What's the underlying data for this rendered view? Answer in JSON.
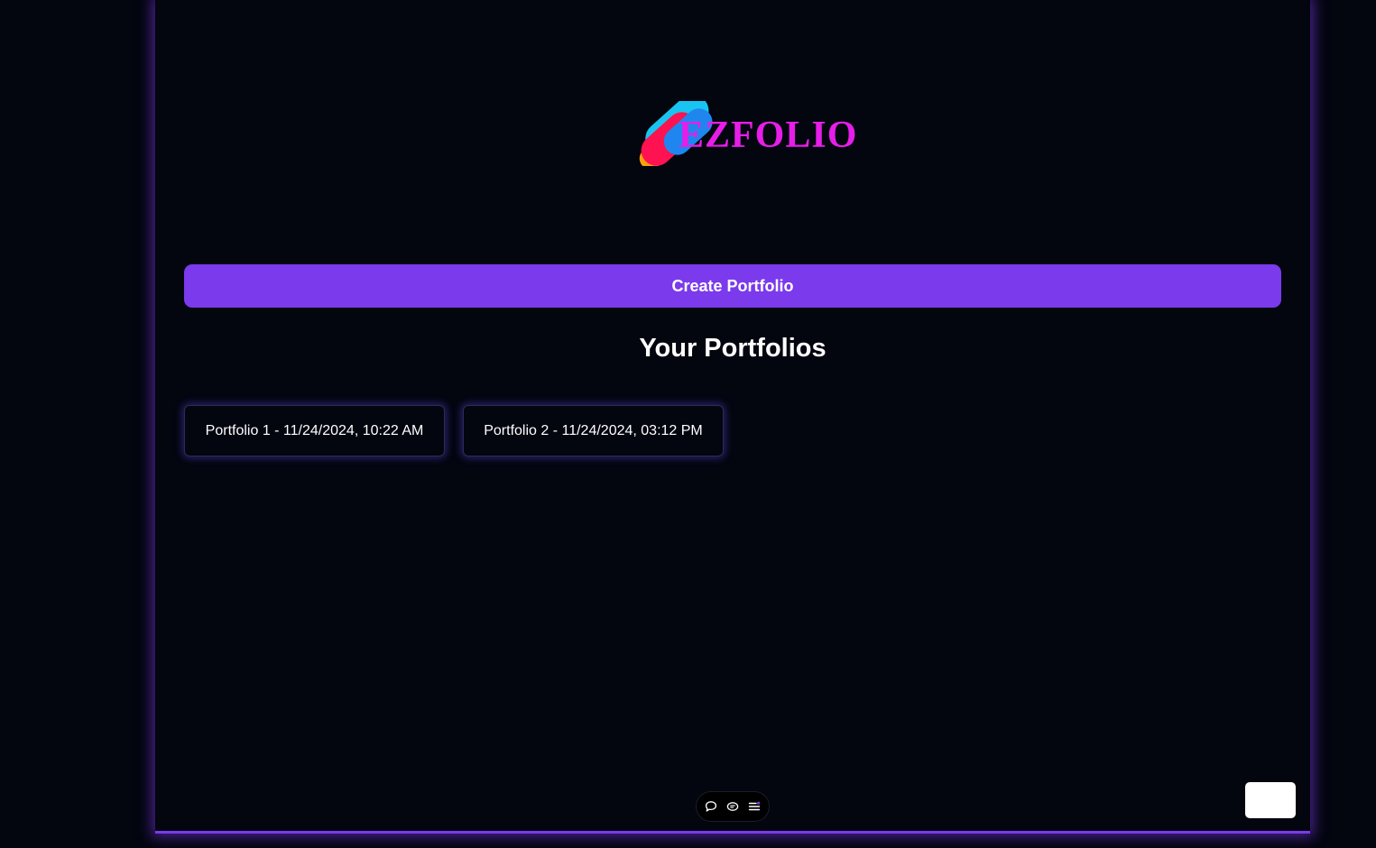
{
  "brand": {
    "name": "EZFOLIO",
    "logo_icon": "ezfolio-logo-icon",
    "text_color": "#e61ee8"
  },
  "actions": {
    "create_label": "Create Portfolio",
    "accent_color": "#7b3aec"
  },
  "portfolios": {
    "title": "Your Portfolios",
    "items": [
      {
        "label": "Portfolio 1 - 11/24/2024, 10:22 AM"
      },
      {
        "label": "Portfolio 2 - 11/24/2024, 03:12 PM"
      }
    ]
  },
  "toolbar": {
    "icons": [
      "comment-icon",
      "view-icon",
      "menu-list-icon"
    ]
  }
}
